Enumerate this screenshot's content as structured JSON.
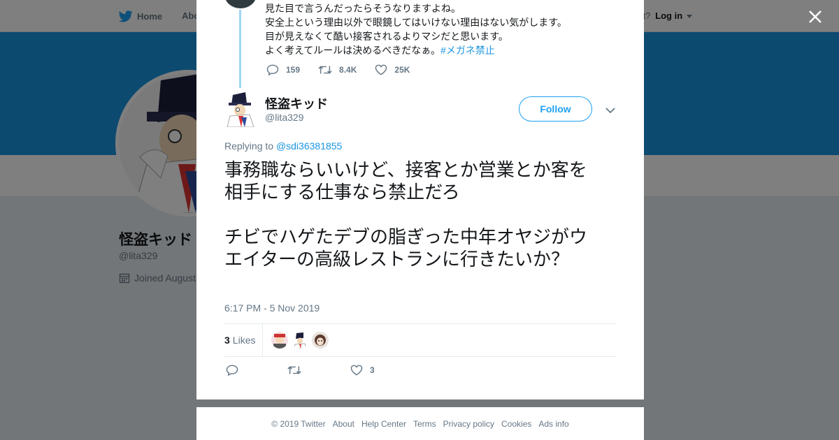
{
  "topbar": {
    "home": "Home",
    "about": "Abo",
    "account_prompt": "ccount?",
    "login": "Log in"
  },
  "profile": {
    "name": "怪盗キッド",
    "handle": "@lita329",
    "joined": "Joined August"
  },
  "previous_tweet": {
    "lines": [
      "見た目で言うんだったらそうなりますよね。",
      "安全上という理由以外で眼鏡してはいけない理由はない気がします。",
      "目が見えなくて酷い接客されるよりマシだと思います。",
      "よく考えてルールは決めるべきだなぁ。"
    ],
    "hashtag": "#メガネ禁止",
    "replies": "159",
    "retweets": "8.4K",
    "likes": "25K"
  },
  "tweet": {
    "name": "怪盗キッド",
    "handle": "@lita329",
    "follow_label": "Follow",
    "replying_prefix": "Replying to",
    "replying_to": "@sdi36381855",
    "paragraph1": "事務職ならいいけど、接客とか営業とか客を相手にする仕事なら禁止だろ",
    "paragraph2": "チビでハゲたデブの脂ぎった中年オヤジがウエイターの高級レストランに行きたいか？",
    "timestamp": "6:17 PM - 5 Nov 2019",
    "likes_count": "3",
    "likes_label": "Likes",
    "like_action_count": "3"
  },
  "footer": {
    "links": [
      "© 2019 Twitter",
      "About",
      "Help Center",
      "Terms",
      "Privacy policy",
      "Cookies",
      "Ads info"
    ]
  },
  "colors": {
    "accent": "#1da1f2",
    "banner": "#1b95e0",
    "thread_line": "#9fd5f6"
  },
  "icons": [
    "twitter-bird-icon",
    "calendar-icon",
    "close-icon",
    "reply-icon",
    "retweet-icon",
    "heart-icon",
    "chevron-down-icon"
  ]
}
